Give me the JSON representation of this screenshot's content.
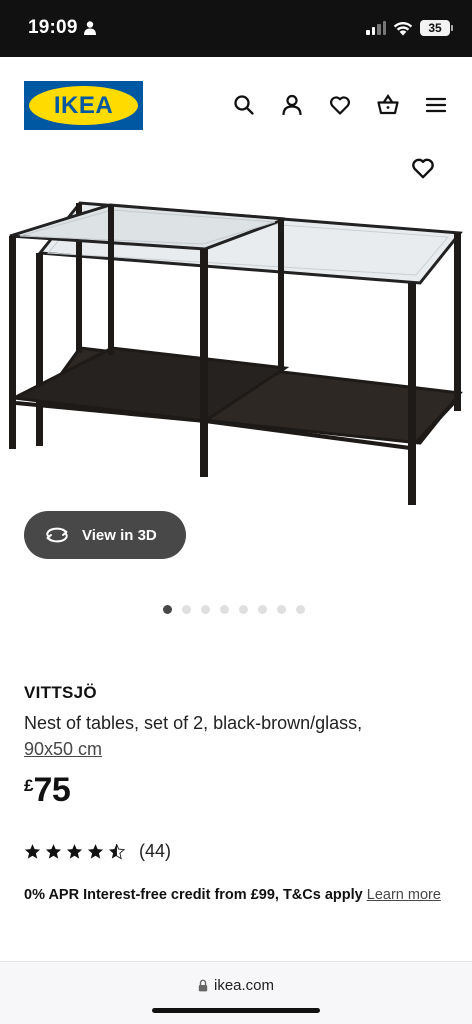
{
  "status_bar": {
    "time": "19:09",
    "battery": "35"
  },
  "header": {
    "logo_text": "IKEA",
    "logo_colors": {
      "blue": "#0058a3",
      "yellow": "#ffdb00"
    },
    "icons": [
      "search-icon",
      "account-icon",
      "heart-icon",
      "basket-icon",
      "menu-icon"
    ]
  },
  "gallery": {
    "view3d_label": "View in 3D",
    "dot_count": 8,
    "active_dot": 0
  },
  "product": {
    "name": "VITTSJÖ",
    "description": "Nest of tables, set of 2, black-brown/glass,",
    "size": "90x50 cm",
    "currency": "£",
    "price": "75",
    "rating_value": 4.5,
    "rating_count": "(44)"
  },
  "credit": {
    "text": "0% APR Interest-free credit from £99, T&Cs apply",
    "link": "Learn more"
  },
  "browser": {
    "url": "ikea.com"
  }
}
